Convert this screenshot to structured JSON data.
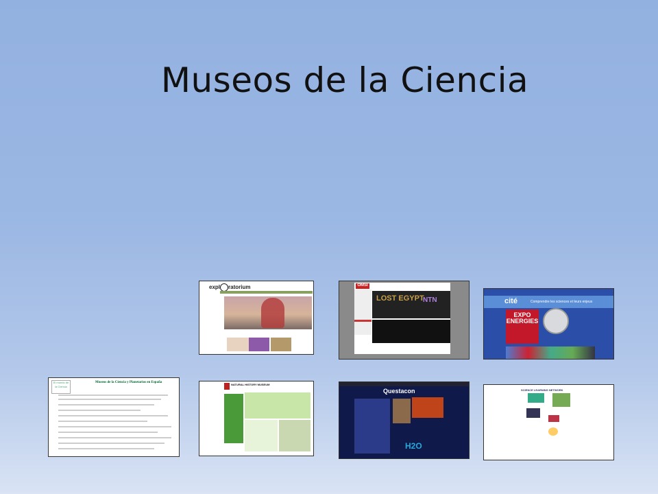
{
  "slide": {
    "title": "Museos de la Ciencia"
  },
  "thumbnails": [
    {
      "logo_text": "expl",
      "logo_text_2": "ratorium",
      "site": "exploratorium"
    },
    {
      "logo_text": "OMSI",
      "hero_text": "LOST EGYPT",
      "side_text": "NTN",
      "site": "omsi"
    },
    {
      "logo_text": "cité",
      "tagline": "Comprendre les sciences et leurs enjeux",
      "feature_text": "EXPO ENERGIES",
      "site": "cite"
    },
    {
      "logo_text": "El mundo de la Ciencia",
      "heading": "Museos de la Ciencia y Planetarios en España",
      "site": "museos"
    },
    {
      "logo_text": "NATURAL HISTORY MUSEUM",
      "site": "nhm"
    },
    {
      "logo_text": "Questacon",
      "feature_text": "H2O",
      "site": "questacon"
    },
    {
      "heading": "SCIENCE LEARNING NETWORK",
      "site": "sln"
    }
  ],
  "colors": {
    "background_top": "#93b1e0",
    "background_bottom": "#d9e3f4"
  }
}
